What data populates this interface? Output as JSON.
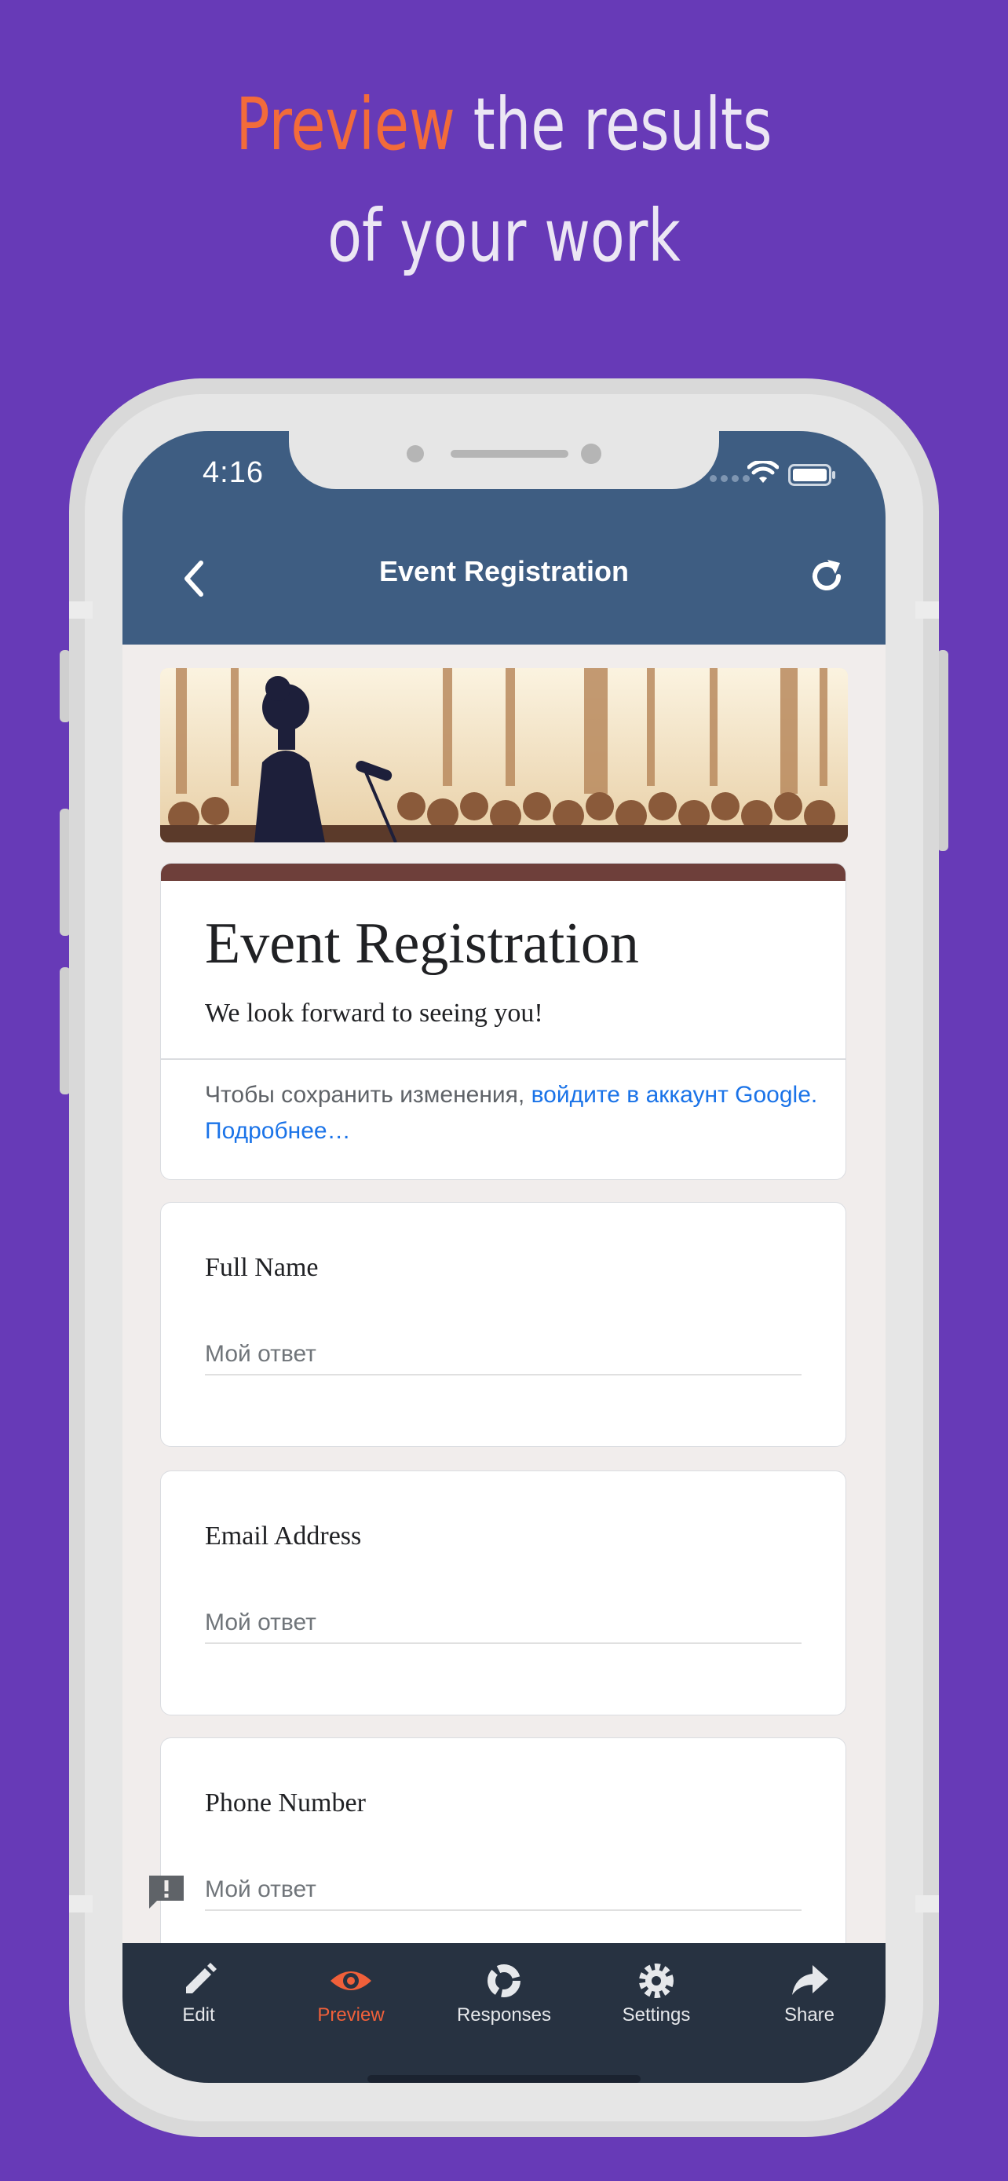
{
  "promo": {
    "headline_accent": "Preview",
    "headline_rest_line1": "the results",
    "headline_line2": "of your work"
  },
  "status_bar": {
    "time": "4:16"
  },
  "nav": {
    "title": "Event Registration",
    "back_icon": "chevron-left-icon",
    "refresh_icon": "refresh-icon"
  },
  "form": {
    "title": "Event Registration",
    "description": "We look forward to seeing you!",
    "signin_text": "Чтобы сохранить изменения, ",
    "signin_link": "войдите в аккаунт Google.",
    "learn_more": "Подробнее…"
  },
  "questions": [
    {
      "label": "Full Name",
      "placeholder": "Мой ответ"
    },
    {
      "label": "Email Address",
      "placeholder": "Мой ответ"
    },
    {
      "label": "Phone Number",
      "placeholder": "Мой ответ"
    }
  ],
  "tabs": [
    {
      "label": "Edit",
      "icon": "pencil-icon"
    },
    {
      "label": "Preview",
      "icon": "eye-icon",
      "active": true
    },
    {
      "label": "Responses",
      "icon": "donut-chart-icon"
    },
    {
      "label": "Settings",
      "icon": "gear-icon"
    },
    {
      "label": "Share",
      "icon": "share-arrow-icon"
    }
  ],
  "colors": {
    "background": "#673ab7",
    "accent": "#f26b3a",
    "header": "#3e5d82",
    "tabbar": "#273241",
    "form_accent": "#6e3f3a",
    "link": "#1a73e8"
  }
}
